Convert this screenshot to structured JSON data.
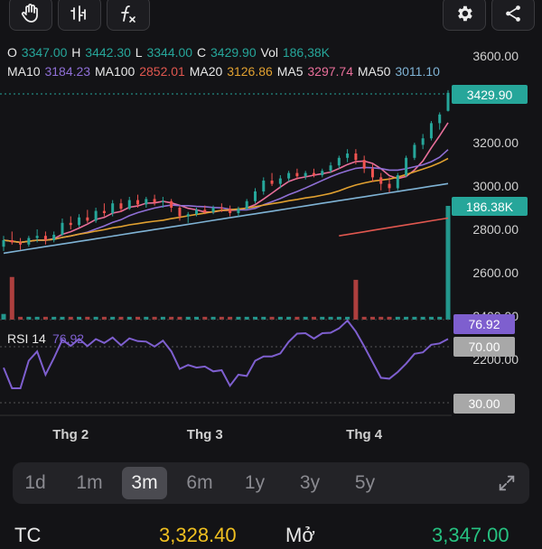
{
  "toolbar": {
    "left_buttons": [
      {
        "icon": "hand-pointer-icon"
      },
      {
        "icon": "candle-tool-icon"
      },
      {
        "icon": "function-icon",
        "label": "fx"
      }
    ],
    "right_buttons": [
      {
        "icon": "gear-icon"
      },
      {
        "icon": "share-icon"
      }
    ]
  },
  "ohlc": {
    "o_label": "O",
    "o_value": "3347.00",
    "h_label": "H",
    "h_value": "3442.30",
    "l_label": "L",
    "l_value": "3344.00",
    "c_label": "C",
    "c_value": "3429.90",
    "vol_label": "Vol",
    "vol_value": "186,38K"
  },
  "ma": {
    "ma10_label": "MA10",
    "ma10_value": "3184.23",
    "ma100_label": "MA100",
    "ma100_value": "2852.01",
    "ma20_label": "MA20",
    "ma20_value": "3126.86",
    "ma5_label": "MA5",
    "ma5_value": "3297.74",
    "ma50_label": "MA50",
    "ma50_value": "3011.10"
  },
  "colors": {
    "up": "#26a69a",
    "down": "#ef5350",
    "ma5": "#e86f9a",
    "ma10": "#8f6fd6",
    "ma20": "#e0a030",
    "ma50": "#7fb3d5",
    "ma100": "#e0574f",
    "rsi": "#7e5fcf",
    "text_gray": "#b0b0b0",
    "accent_gold": "#f0c020"
  },
  "chart_data": {
    "type": "candlestick",
    "x_ticks": [
      "Thg 2",
      "Thg 3",
      "Thg 4"
    ],
    "price_axis": [
      "3600.00",
      "3200.00",
      "3000.00",
      "2800.00",
      "2600.00",
      "2400.00",
      "2200.00"
    ],
    "ylim": [
      2260,
      3640
    ],
    "last_price_label": "3429.90",
    "last_volume_label": "186.38K",
    "rsi_label": "RSI 14",
    "rsi_value": "76.92",
    "rsi_levels": [
      "70.00",
      "30.00"
    ],
    "rsi_current_label": "76.92",
    "candles": [
      [
        2720,
        2770,
        2700,
        2750
      ],
      [
        2750,
        2790,
        2730,
        2740
      ],
      [
        2740,
        2760,
        2705,
        2730
      ],
      [
        2730,
        2770,
        2720,
        2760
      ],
      [
        2760,
        2800,
        2740,
        2770
      ],
      [
        2770,
        2790,
        2730,
        2750
      ],
      [
        2750,
        2790,
        2740,
        2775
      ],
      [
        2775,
        2850,
        2770,
        2830
      ],
      [
        2830,
        2860,
        2800,
        2820
      ],
      [
        2820,
        2870,
        2810,
        2855
      ],
      [
        2855,
        2890,
        2830,
        2840
      ],
      [
        2840,
        2900,
        2830,
        2885
      ],
      [
        2885,
        2920,
        2860,
        2875
      ],
      [
        2875,
        2935,
        2860,
        2920
      ],
      [
        2920,
        2940,
        2880,
        2895
      ],
      [
        2895,
        2950,
        2890,
        2935
      ],
      [
        2935,
        2960,
        2900,
        2915
      ],
      [
        2915,
        2950,
        2900,
        2940
      ],
      [
        2940,
        2960,
        2910,
        2925
      ],
      [
        2925,
        2950,
        2900,
        2930
      ],
      [
        2930,
        2940,
        2880,
        2900
      ],
      [
        2900,
        2910,
        2840,
        2860
      ],
      [
        2860,
        2880,
        2830,
        2870
      ],
      [
        2870,
        2900,
        2860,
        2890
      ],
      [
        2890,
        2910,
        2870,
        2880
      ],
      [
        2880,
        2910,
        2870,
        2900
      ],
      [
        2900,
        2920,
        2880,
        2895
      ],
      [
        2895,
        2910,
        2860,
        2875
      ],
      [
        2875,
        2905,
        2860,
        2895
      ],
      [
        2895,
        2940,
        2890,
        2930
      ],
      [
        2930,
        2990,
        2920,
        2975
      ],
      [
        2975,
        3040,
        2960,
        3025
      ],
      [
        3025,
        3060,
        3000,
        3010
      ],
      [
        3010,
        3050,
        2990,
        3035
      ],
      [
        3035,
        3070,
        3020,
        3060
      ],
      [
        3060,
        3080,
        3030,
        3045
      ],
      [
        3045,
        3070,
        3030,
        3060
      ],
      [
        3060,
        3080,
        3040,
        3050
      ],
      [
        3050,
        3080,
        3040,
        3070
      ],
      [
        3070,
        3110,
        3060,
        3095
      ],
      [
        3095,
        3140,
        3080,
        3130
      ],
      [
        3130,
        3170,
        3110,
        3150
      ],
      [
        3150,
        3170,
        3100,
        3120
      ],
      [
        3120,
        3140,
        3060,
        3080
      ],
      [
        3080,
        3100,
        3020,
        3040
      ],
      [
        3040,
        3060,
        2980,
        3010
      ],
      [
        3010,
        3040,
        2970,
        2990
      ],
      [
        2990,
        3060,
        2980,
        3050
      ],
      [
        3050,
        3140,
        3040,
        3130
      ],
      [
        3130,
        3200,
        3120,
        3190
      ],
      [
        3190,
        3240,
        3170,
        3220
      ],
      [
        3220,
        3300,
        3210,
        3290
      ],
      [
        3290,
        3340,
        3260,
        3330
      ],
      [
        3347,
        3442,
        3344,
        3430
      ]
    ],
    "volumes": [
      2,
      15,
      1,
      1,
      1,
      1,
      1,
      1,
      1,
      1,
      1,
      1,
      1,
      1,
      1,
      1,
      1,
      1,
      1,
      1,
      1,
      1,
      1,
      1,
      1,
      1,
      1,
      1,
      1,
      1,
      1,
      1,
      1,
      1,
      1,
      1,
      1,
      1,
      1,
      1,
      1,
      1,
      14,
      1,
      1,
      1,
      1,
      1,
      1,
      1,
      1,
      1,
      1,
      40
    ]
  },
  "timeframes": [
    "1d",
    "1m",
    "3m",
    "6m",
    "1y",
    "3y",
    "5y"
  ],
  "active_timeframe": "3m",
  "bottom": {
    "tc_label": "TC",
    "tc_value": "3,328.40",
    "open_label": "Mở",
    "open_value": "3,347.00"
  }
}
